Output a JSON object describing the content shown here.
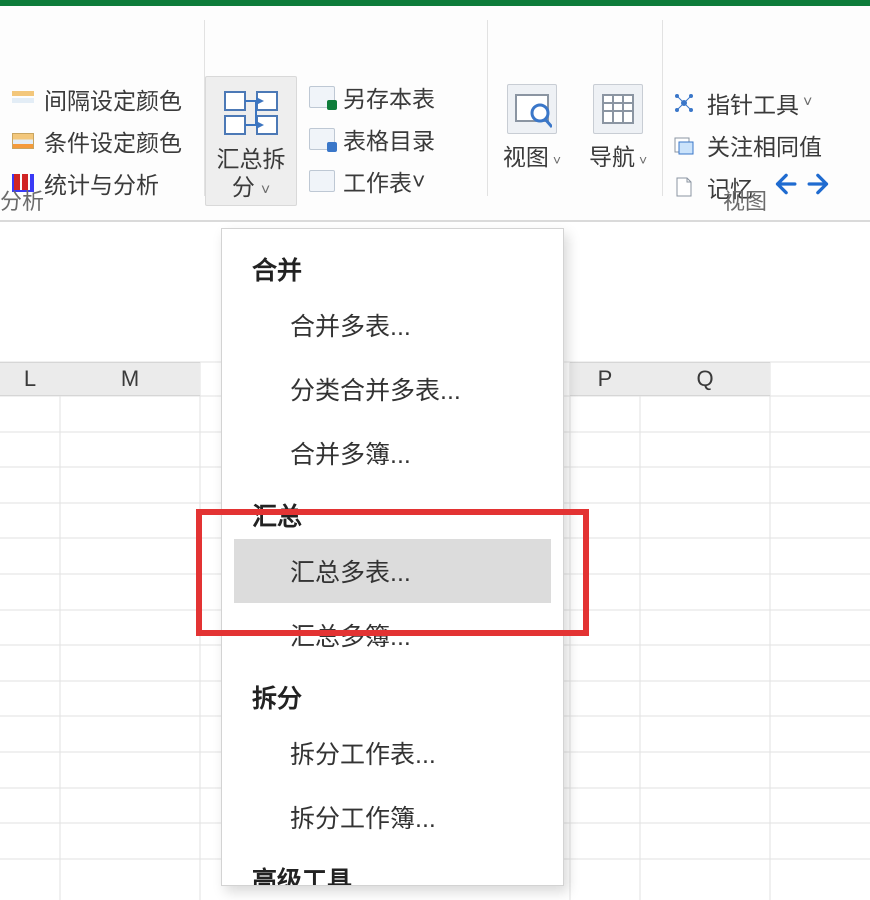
{
  "ribbon": {
    "analysis": {
      "interval_color": "间隔设定颜色",
      "conditional_color": "条件设定颜色",
      "stats_analysis": "统计与分析",
      "group_label": "分析"
    },
    "sheets": {
      "big_button": "汇总拆分",
      "big_button_chevron": "˅",
      "save_sheet": "另存本表",
      "sheet_catalog": "表格目录",
      "worksheet": "工作表",
      "worksheet_chevron": "˅"
    },
    "view": {
      "view_mode": "视图",
      "navigation": "导航",
      "chevron": "˅",
      "group_label": "视图"
    },
    "misc": {
      "pointer_tool": "指针工具",
      "follow_same_value": "关注相同值",
      "memory": "记忆",
      "chevron": "˅"
    }
  },
  "columns": {
    "L": "L",
    "M": "M",
    "P": "P",
    "Q": "Q"
  },
  "menu": {
    "sect_merge": "合并",
    "merge_sheets": "合并多表...",
    "category_merge": "分类合并多表...",
    "merge_books": "合并多簿...",
    "sect_summary": "汇总",
    "summary_sheets": "汇总多表...",
    "summary_books": "汇总多簿...",
    "sect_split": "拆分",
    "split_sheet": "拆分工作表...",
    "split_book": "拆分工作簿...",
    "sect_adv": "高级工具"
  }
}
